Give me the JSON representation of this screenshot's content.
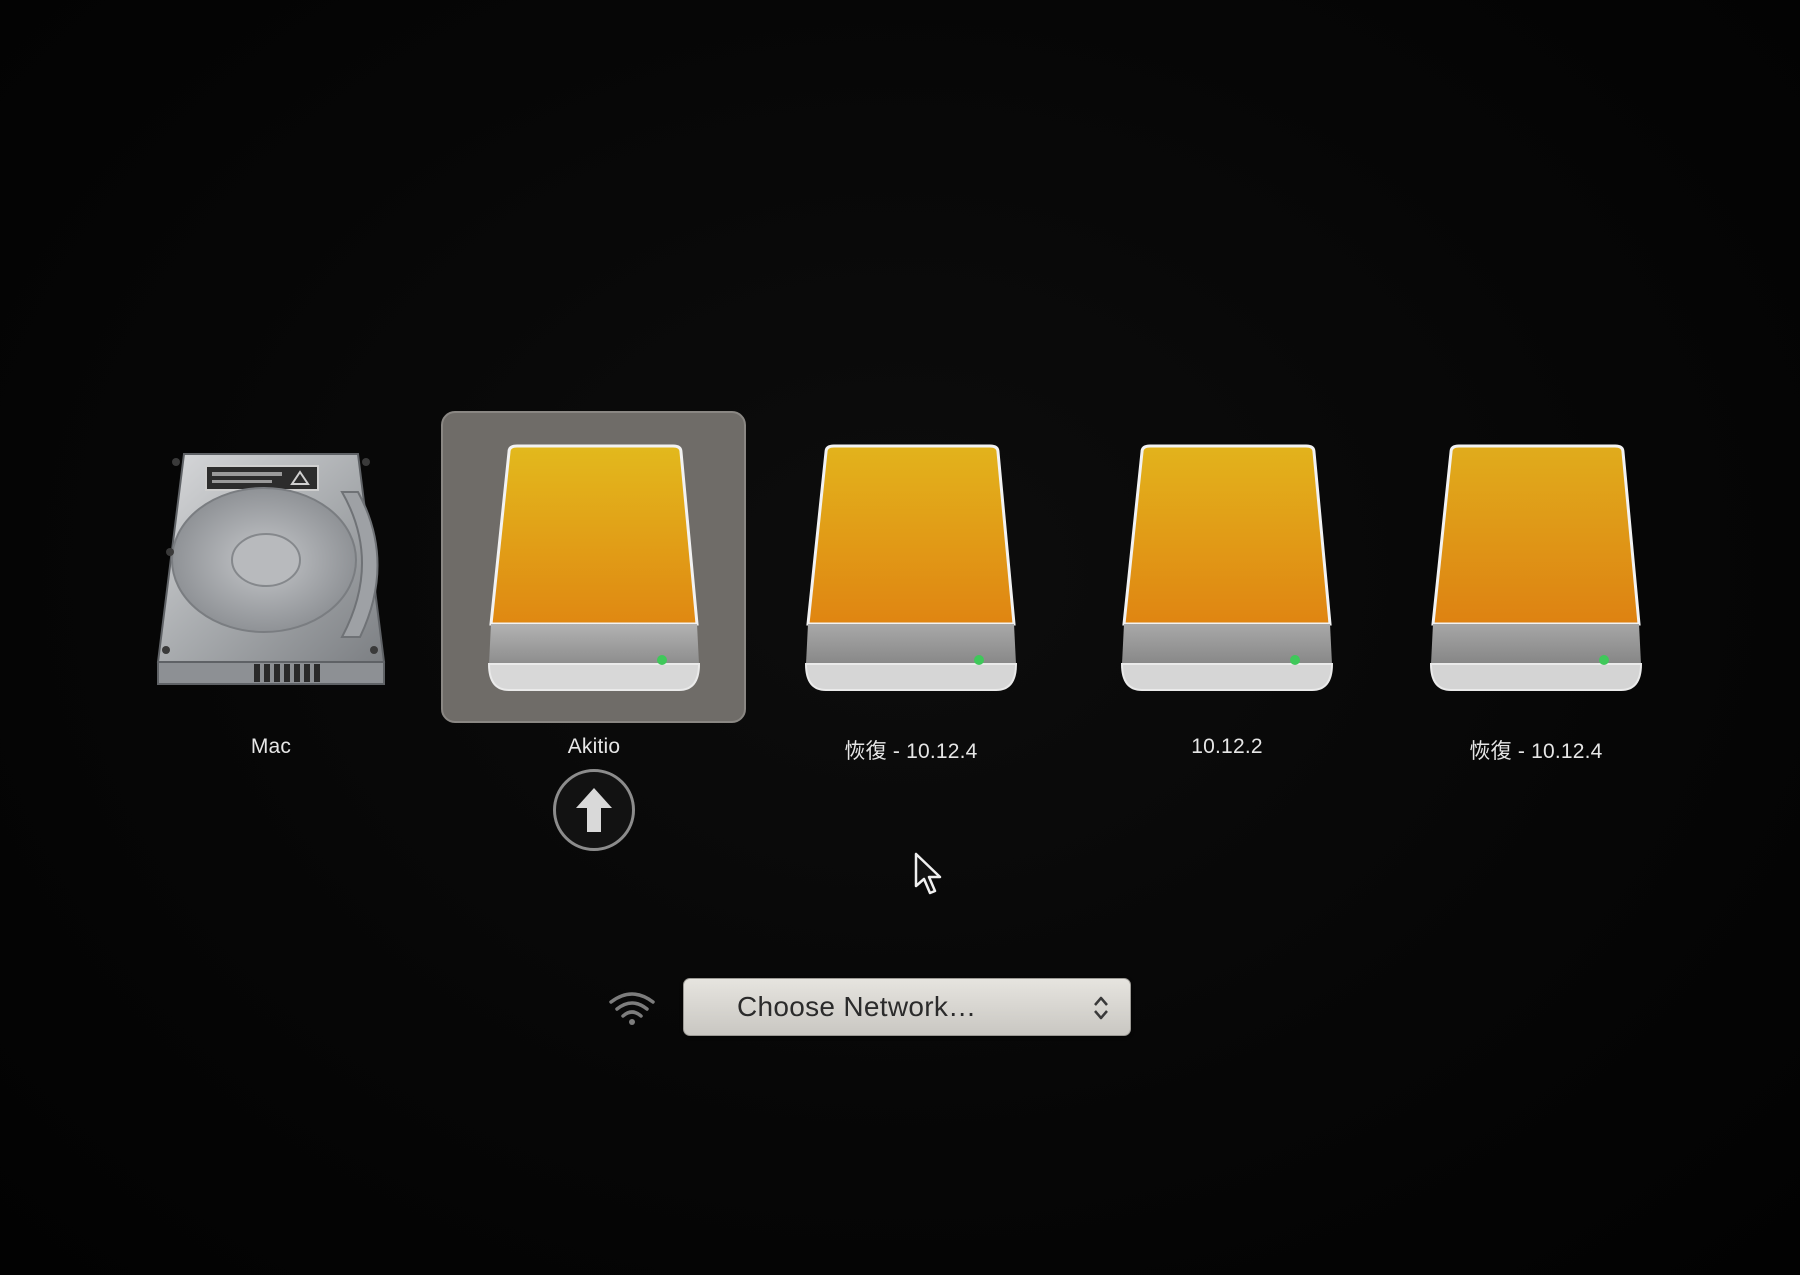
{
  "boot_picker": {
    "disks": [
      {
        "label": "Mac",
        "icon": "internal-hard-drive-icon",
        "selected": false
      },
      {
        "label": "Akitio",
        "icon": "external-drive-icon",
        "selected": true
      },
      {
        "label": "恢復 - 10.12.4",
        "icon": "external-drive-icon",
        "selected": false
      },
      {
        "label": "10.12.2",
        "icon": "external-drive-icon",
        "selected": false
      },
      {
        "label": "恢復 - 10.12.4",
        "icon": "external-drive-icon",
        "selected": false
      }
    ],
    "boot_button_icon": "arrow-up-circle-icon"
  },
  "network": {
    "wifi_icon": "wifi-icon",
    "popup_label": "Choose Network…",
    "popup_icon": "up-down-chevron-icon"
  },
  "colors": {
    "background": "#050505",
    "selection": "#6f6c68",
    "drive_orange_top": "#e0b21c",
    "drive_orange_bottom": "#e08812",
    "drive_body": "#a9a9a9",
    "led_green": "#3fc85a",
    "label_text": "#e6e6e6"
  }
}
